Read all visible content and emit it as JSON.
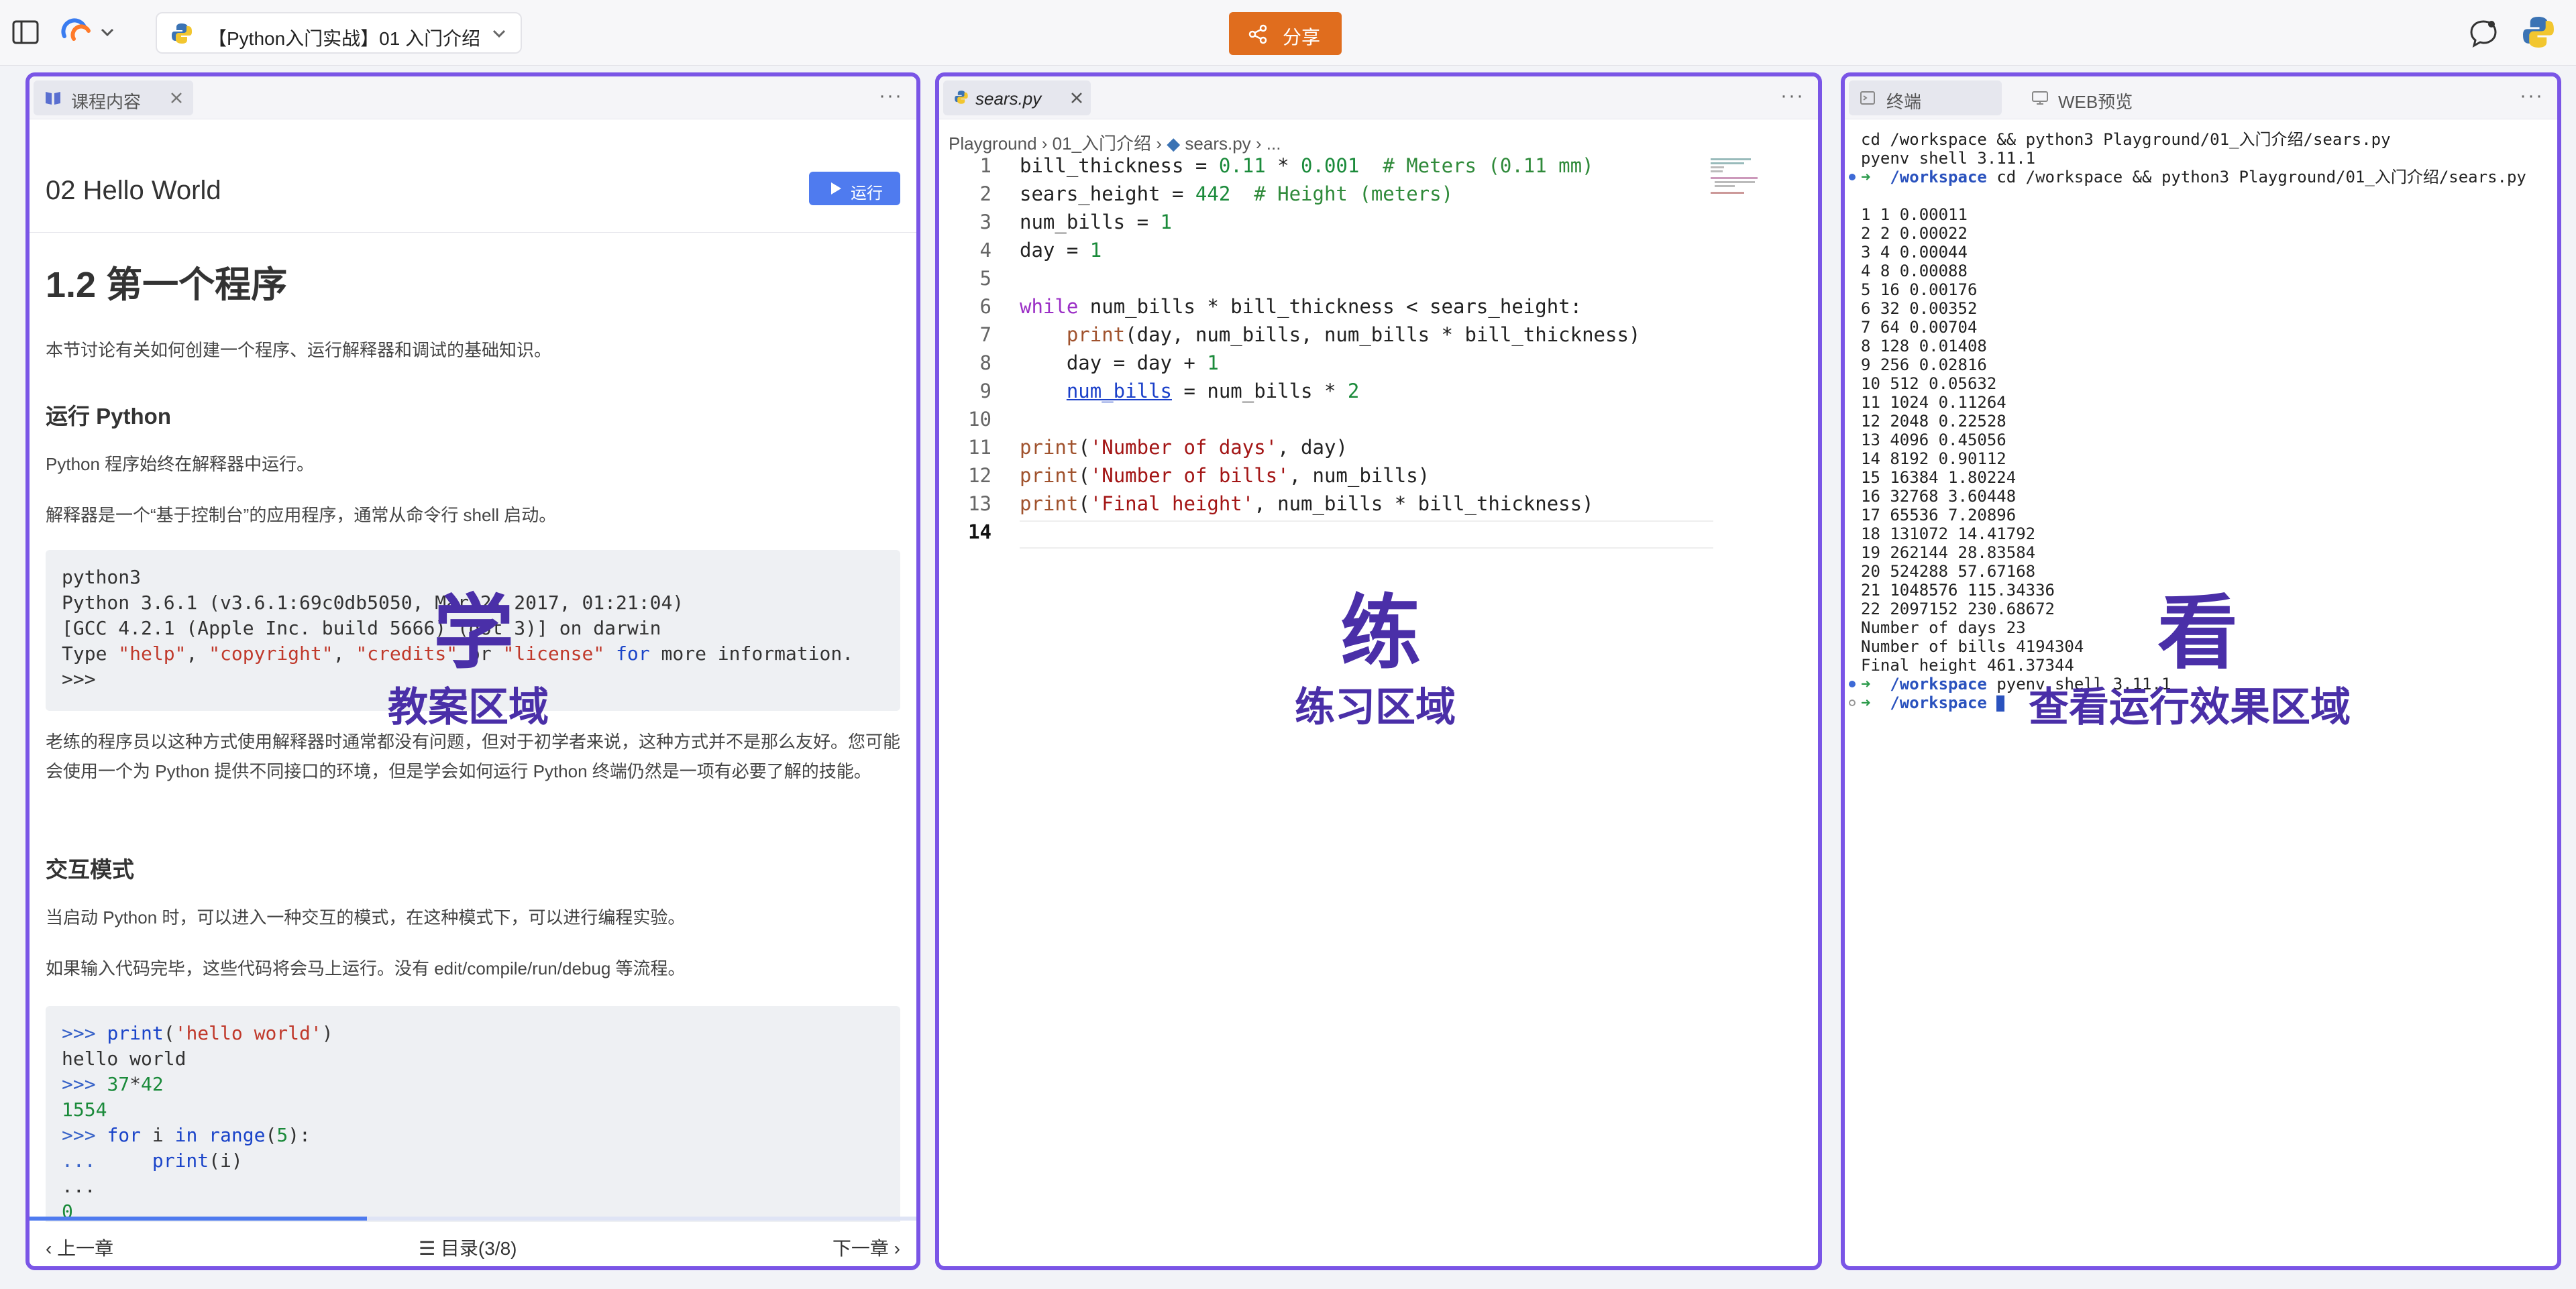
{
  "topbar": {
    "course_title": "【Python入门实战】01 入门介绍",
    "share_label": "分享"
  },
  "left_panel": {
    "tab_label": "课程内容",
    "lesson_title": "02 Hello World",
    "run_label": "运行",
    "section_title": "1.2 第一个程序",
    "intro": "本节讨论有关如何创建一个程序、运行解释器和调试的基础知识。",
    "h_run": "运行 Python",
    "p_run1": "Python 程序始终在解释器中运行。",
    "p_run2": "解释器是一个“基于控制台”的应用程序，通常从命令行 shell 启动。",
    "code1": [
      "python3",
      "Python 3.6.1 (v3.6.1:69c0db5050, Mar 21 2017, 01:21:04)",
      "[GCC 4.2.1 (Apple Inc. build 5666) (dot 3)] on darwin",
      "Type \"help\", \"copyright\", \"credits\" or \"license\" for more information.",
      ">>>"
    ],
    "p_old": "老练的程序员以这种方式使用解释器时通常都没有问题，但对于初学者来说，这种方式并不是那么友好。您可能会使用一个为 Python 提供不同接口的环境，但是学会如何运行 Python 终端仍然是一项有必要了解的技能。",
    "h_interactive": "交互模式",
    "p_inter1": "当启动 Python 时，可以进入一种交互的模式，在这种模式下，可以进行编程实验。",
    "p_inter2": "如果输入代码完毕，这些代码将会马上运行。没有 edit/compile/run/debug 等流程。",
    "code2": [
      ">>> print('hello world')",
      "hello world",
      ">>> 37*42",
      "1554",
      ">>> for i in range(5):",
      "...     print(i)",
      "...",
      "0"
    ],
    "prev_label": "上一章",
    "toc_label": "目录(3/8)",
    "next_label": "下一章",
    "progress": 0.38
  },
  "mid_panel": {
    "tab_label": "sears.py",
    "breadcrumb": [
      "Playground",
      "01_入门介绍",
      "sears.py",
      "..."
    ],
    "current_line": "14"
  },
  "right_panel": {
    "tab_terminal": "终端",
    "tab_web": "WEB预览",
    "cmd1": "cd /workspace && python3 Playground/01_入门介绍/sears.py",
    "cmd1b": "pyenv shell 3.11.1",
    "prompt_dir": "/workspace",
    "cmd2": "cd /workspace && python3 Playground/01_入门介绍/sears.py",
    "output": [
      "1 1 0.00011",
      "2 2 0.00022",
      "3 4 0.00044",
      "4 8 0.00088",
      "5 16 0.00176",
      "6 32 0.00352",
      "7 64 0.00704",
      "8 128 0.01408",
      "9 256 0.02816",
      "10 512 0.05632",
      "11 1024 0.11264",
      "12 2048 0.22528",
      "13 4096 0.45056",
      "14 8192 0.90112",
      "15 16384 1.80224",
      "16 32768 3.60448",
      "17 65536 7.20896",
      "18 131072 14.41792",
      "19 262144 28.83584",
      "20 524288 57.67168",
      "21 1048576 115.34336",
      "22 2097152 230.68672",
      "Number of days 23",
      "Number of bills 4194304",
      "Final height 461.37344"
    ],
    "cmd3": "pyenv shell 3.11.1"
  },
  "annotations": {
    "learn_big": "学",
    "learn_label": "教案区域",
    "practice_big": "练",
    "practice_label": "练习区域",
    "view_big": "看",
    "view_label": "查看运行效果区域"
  },
  "colors": {
    "panel_border": "#7a55e6",
    "share": "#e06d1e",
    "run": "#4f7bef",
    "annotation": "#4a2fa8"
  }
}
